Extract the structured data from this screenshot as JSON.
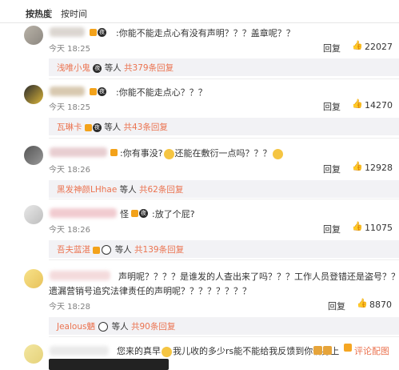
{
  "sort": {
    "hot": "按热度",
    "time": "按时间"
  },
  "common": {
    "reply_label": "回复",
    "thumb_icon": "thumbs-up-icon"
  },
  "comments": [
    {
      "text": ":你能不能走点心有没有声明？？？盖章呢？？",
      "time": "今天 18:25",
      "likes": "22027",
      "reply": {
        "name": "浅唯小鬼",
        "mid": "等人",
        "count": "共379条回复"
      }
    },
    {
      "text": ":你能不能走点心？？？",
      "time": "今天 18:25",
      "likes": "14270",
      "reply": {
        "name": "瓦琳卡",
        "mid": "等人",
        "count": "共43条回复"
      }
    },
    {
      "text_a": ":你有事没?",
      "text_b": "还能在敷衍一点吗？？？",
      "time": "今天 18:26",
      "likes": "12928",
      "reply": {
        "name": "黑发神颜LHhae",
        "mid": "等人",
        "count": "共62条回复"
      }
    },
    {
      "text": ":放了个屁?",
      "name_tail": "怪",
      "time": "今天 18:26",
      "likes": "11075",
      "reply": {
        "name": "吾夫蓝湛",
        "mid": "等人",
        "count": "共139条回复"
      }
    },
    {
      "line1": "声明呢？？？？是谁发的人查出来了吗？？？工作人员登错还是盗号？？？？",
      "line2": "遗漏营销号追究法律责任的声明呢？？？？？？？？",
      "time": "今天 18:28",
      "likes": "8870",
      "reply": {
        "name": "Jealous魉",
        "mid": "等人",
        "count": "共90条回复"
      }
    },
    {
      "text_a": "您来的真早",
      "text_b": "我儿收的多少rs能不能给我反馈到你们身上",
      "report": "评论配图"
    }
  ]
}
